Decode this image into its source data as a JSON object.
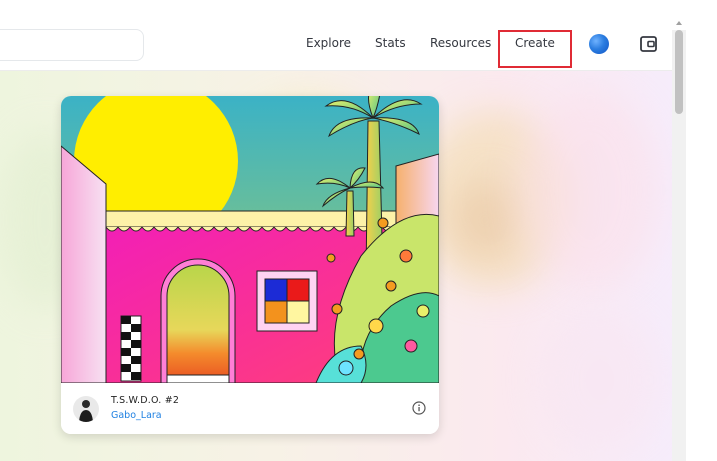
{
  "nav": {
    "items": [
      "Explore",
      "Stats",
      "Resources",
      "Create"
    ]
  },
  "icons": {
    "avatar": "profile-avatar",
    "wallet": "wallet-icon",
    "info": "info-icon"
  },
  "card": {
    "title": "T.S.W.D.O. #2",
    "creator": "Gabo_Lara"
  },
  "colors": {
    "highlight": "#e02b35",
    "link": "#2081e2",
    "text": "#353840"
  }
}
